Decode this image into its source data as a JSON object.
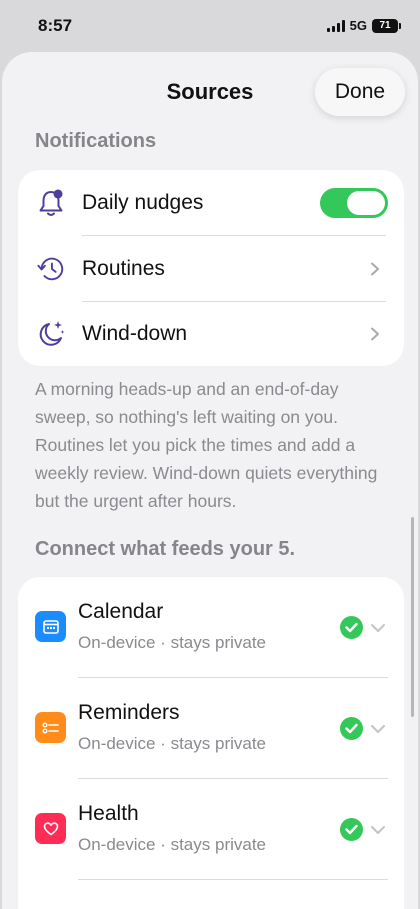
{
  "status_bar": {
    "time": "8:57",
    "network": "5G",
    "battery": "71"
  },
  "sheet": {
    "title": "Sources",
    "done_label": "Done"
  },
  "notifications": {
    "header": "Notifications",
    "items": [
      {
        "label": "Daily nudges",
        "icon": "bell-icon",
        "control": "toggle",
        "enabled": true
      },
      {
        "label": "Routines",
        "icon": "clock-history-icon",
        "control": "chevron"
      },
      {
        "label": "Wind-down",
        "icon": "moon-stars-icon",
        "control": "chevron"
      }
    ],
    "description": "A morning heads-up and an end-of-day sweep, so nothing's left waiting on you. Routines let you pick the times and add a weekly review. Wind-down quiets everything but the urgent after hours."
  },
  "sources": {
    "header": "Connect what feeds your 5.",
    "items": [
      {
        "name": "Calendar",
        "subtitle": "On-device · stays private",
        "icon": "calendar-icon",
        "color": "#1a8cff",
        "connected": true
      },
      {
        "name": "Reminders",
        "subtitle": "On-device · stays private",
        "icon": "reminders-icon",
        "color": "#ff8c1a",
        "connected": true
      },
      {
        "name": "Health",
        "subtitle": "On-device · stays private",
        "icon": "heart-icon",
        "color": "#ff2d55",
        "connected": true
      }
    ]
  },
  "colors": {
    "accent_purple": "#4b3f9e",
    "toggle_green": "#34c759",
    "check_green": "#34c759"
  }
}
